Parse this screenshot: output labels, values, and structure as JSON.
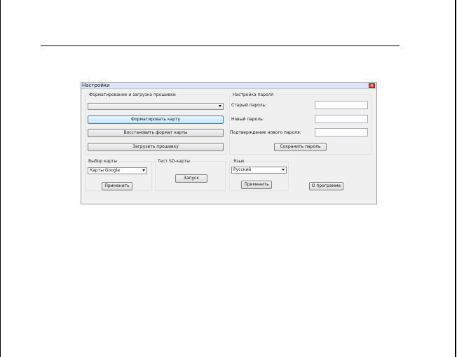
{
  "window": {
    "title": "Настройки",
    "close_glyph": "✕"
  },
  "format_group": {
    "label": "Форматирование и загрузка прошивки",
    "combo_value": "",
    "format_button": "Форматировать карту",
    "restore_button": "Восстановить формат карты",
    "upload_button": "Загрузить прошивку"
  },
  "password_group": {
    "label": "Настройка пароля",
    "old_password_label": "Старый пароль:",
    "new_password_label": "Новый пароль:",
    "confirm_password_label": "Подтверждение нового пароля:",
    "old_password_value": "",
    "new_password_value": "",
    "confirm_password_value": "",
    "save_button": "Сохранить пароль"
  },
  "map_group": {
    "label": "Выбор карты",
    "combo_value": "Карты Google",
    "apply_button": "Применить"
  },
  "sd_group": {
    "label": "Тест SD-карты",
    "run_button": "Запуск"
  },
  "language_group": {
    "label": "Язык",
    "combo_value": "Русский",
    "apply_button": "Применить"
  },
  "about_button": "О программе",
  "icons": {
    "dropdown": "chevron-down-icon",
    "close": "close-icon"
  },
  "colors": {
    "titlebar": "#dde6f2",
    "window_bg": "#f0f0f0",
    "close_button": "#c9463d",
    "focused_button_border": "#3c7fb1"
  }
}
